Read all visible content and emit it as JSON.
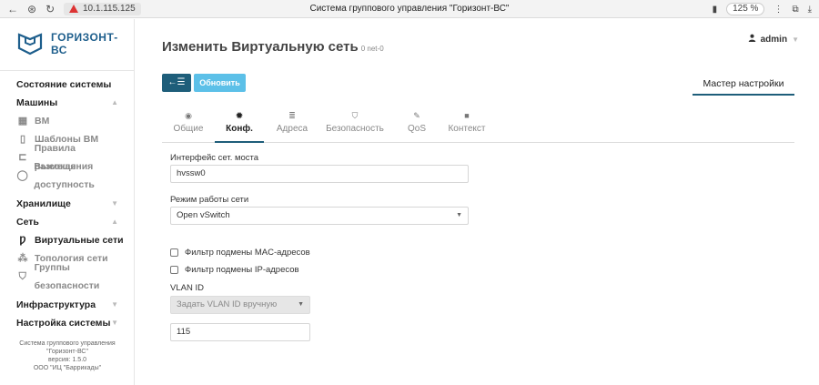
{
  "browser": {
    "url": "10.1.115.125",
    "page_title": "Система группового управления \"Горизонт-ВС\"",
    "zoom": "125 %"
  },
  "sidebar": {
    "logo_text": "ГОРИЗОНТ-ВС",
    "sections": {
      "system_state": "Состояние системы",
      "machines": "Машины",
      "storage": "Хранилище",
      "network": "Сеть",
      "infrastructure": "Инфраструктура",
      "settings": "Настройка системы"
    },
    "machines_items": {
      "vm": "ВМ",
      "templates": "Шаблоны ВМ",
      "placement": "Правила размещения",
      "ha": "Высокая доступность"
    },
    "network_items": {
      "vnets": "Виртуальные сети",
      "topology": "Топология сети",
      "secgroups": "Группы безопасности"
    },
    "footer": {
      "line1": "Система группового управления",
      "line2": "\"Горизонт-ВС\"",
      "line3": "версия: 1.5.0",
      "line4": "ООО \"ИЦ \"Баррикады\""
    }
  },
  "header": {
    "title": "Изменить Виртуальную сеть",
    "subtitle": "0 net-0",
    "user": "admin"
  },
  "toolbar": {
    "refresh_label": "Обновить",
    "wizard_label": "Мастер настройки"
  },
  "tabs": {
    "general": "Общие",
    "conf": "Конф.",
    "addresses": "Адреса",
    "security": "Безопасность",
    "qos": "QoS",
    "context": "Контекст"
  },
  "form": {
    "bridge_label": "Интерфейс сет. моста",
    "bridge_value": "hvssw0",
    "mode_label": "Режим работы сети",
    "mode_value": "Open vSwitch",
    "mac_filter_label": "Фильтр подмены MAC-адресов",
    "ip_filter_label": "Фильтр подмены IP-адресов",
    "vlan_label": "VLAN ID",
    "vlan_mode_value": "Задать VLAN ID вручную",
    "vlan_value": "115"
  },
  "colors": {
    "brand": "#1d5e8c",
    "primary_button": "#1e5e7a",
    "refresh_button": "#5cc0e8"
  }
}
